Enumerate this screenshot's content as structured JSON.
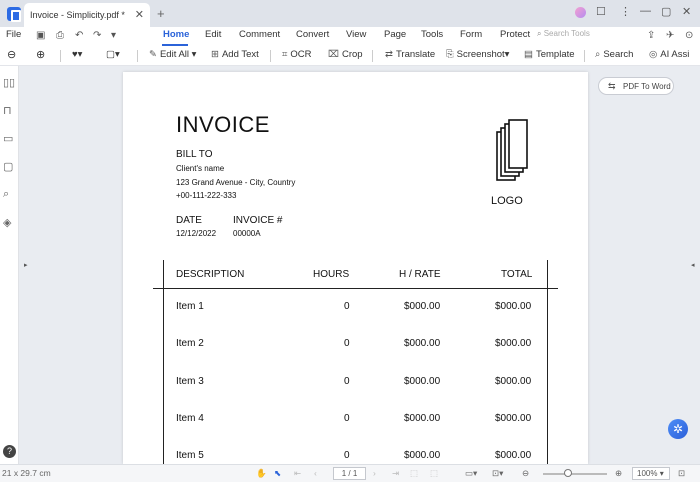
{
  "titlebar": {
    "tab_title": "Invoice - Simplicity.pdf *",
    "close": "✕",
    "new_tab": "+",
    "controls": [
      "☐",
      "⋮",
      "—",
      "▢",
      "✕"
    ]
  },
  "menubar": {
    "file": "File",
    "items": [
      "Home",
      "Edit",
      "Comment",
      "Convert",
      "View",
      "Page",
      "Tools",
      "Form",
      "Protect"
    ],
    "active": "Home",
    "search_placeholder": "Search Tools",
    "right_icons": [
      "⇪",
      "✈",
      "⊙"
    ]
  },
  "toolbar": {
    "items": [
      {
        "icon": "✎",
        "label": "Edit All"
      },
      {
        "icon": "⊞",
        "label": "Add Text"
      },
      {
        "icon": "⌗",
        "label": "OCR"
      },
      {
        "icon": "⌧",
        "label": "Crop"
      },
      {
        "icon": "⇄",
        "label": "Translate"
      },
      {
        "icon": "⎘",
        "label": "Screenshot"
      },
      {
        "icon": "▤",
        "label": "Template"
      },
      {
        "icon": "⌕",
        "label": "Search"
      },
      {
        "icon": "◎",
        "label": "AI Assi"
      }
    ]
  },
  "side_panel": {
    "pdf_to_word": "PDF To Word",
    "help": "?"
  },
  "invoice": {
    "title": "INVOICE",
    "bill_to_label": "BILL TO",
    "client_lines": [
      "Client's name",
      "123 Grand Avenue - City, Country",
      "+00-111-222-333"
    ],
    "date_label": "DATE",
    "date_value": "12/12/2022",
    "invoice_no_label": "INVOICE #",
    "invoice_no_value": "00000A",
    "logo_label": "LOGO",
    "table": {
      "headers": [
        "DESCRIPTION",
        "HOURS",
        "H / RATE",
        "TOTAL"
      ],
      "rows": [
        [
          "Item 1",
          "0",
          "$000.00",
          "$000.00"
        ],
        [
          "Item 2",
          "0",
          "$000.00",
          "$000.00"
        ],
        [
          "Item 3",
          "0",
          "$000.00",
          "$000.00"
        ],
        [
          "Item 4",
          "0",
          "$000.00",
          "$000.00"
        ],
        [
          "Item 5",
          "0",
          "$000.00",
          "$000.00"
        ]
      ]
    }
  },
  "statusbar": {
    "page_size": "21 x 29.7 cm",
    "page_indicator": "1 / 1",
    "zoom": "100%"
  }
}
